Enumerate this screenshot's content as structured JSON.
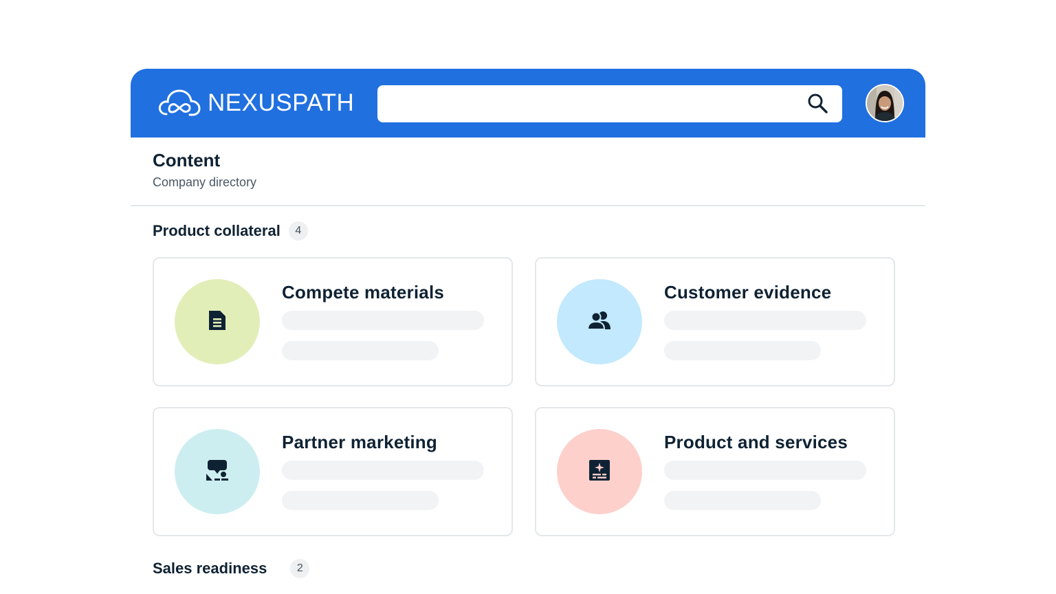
{
  "brand": {
    "name": "NEXUSPATH",
    "logo_icon": "cloud-infinity-icon"
  },
  "search": {
    "value": "",
    "placeholder": "",
    "icon": "search-icon"
  },
  "user": {
    "avatar": "user-avatar"
  },
  "page": {
    "title": "Content",
    "subtitle": "Company directory"
  },
  "sections": [
    {
      "title": "Product collateral",
      "count": "4",
      "cards": [
        {
          "title": "Compete materials",
          "icon": "document-icon",
          "color": "#e2eeb8"
        },
        {
          "title": "Customer evidence",
          "icon": "users-icon",
          "color": "#c2e9fd"
        },
        {
          "title": "Partner marketing",
          "icon": "handshake-chat-icon",
          "color": "#cdeef1"
        },
        {
          "title": "Product and services",
          "icon": "sparkle-board-icon",
          "color": "#fdd0cc"
        }
      ]
    },
    {
      "title": "Sales readiness",
      "count": "2"
    }
  ],
  "colors": {
    "header": "#2070e0",
    "text": "#0f2233",
    "skeleton": "#f1f3f5"
  }
}
